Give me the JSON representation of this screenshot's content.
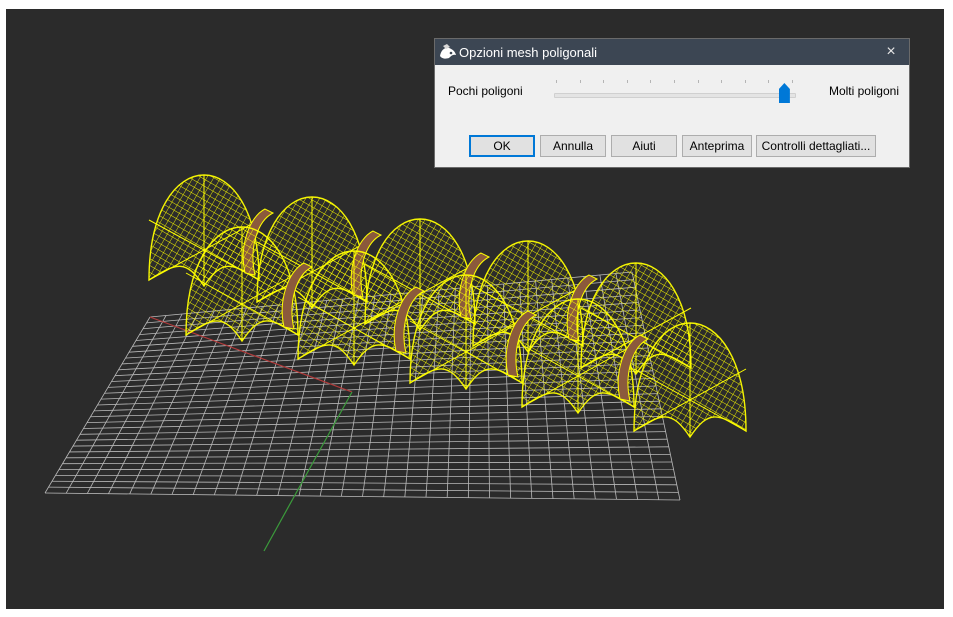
{
  "dialog": {
    "title": "Opzioni mesh poligonali",
    "close_glyph": "×",
    "slider": {
      "left_label": "Pochi poligoni",
      "right_label": "Molti poligoni",
      "value_fraction": 0.96
    },
    "buttons": {
      "ok": "OK",
      "cancel": "Annulla",
      "help": "Aiuti",
      "preview": "Anteprima",
      "detailed": "Controlli dettagliati..."
    }
  },
  "viewport": {
    "background_color": "#2b2b2b",
    "grid_color": "#b9b9b9",
    "x_axis_color": "#b33b3b",
    "y_axis_color": "#3b9b3b",
    "mesh_color": "#ffff00",
    "band_color": "#8b5a3c"
  },
  "icons": [
    "app-icon",
    "close-icon"
  ]
}
